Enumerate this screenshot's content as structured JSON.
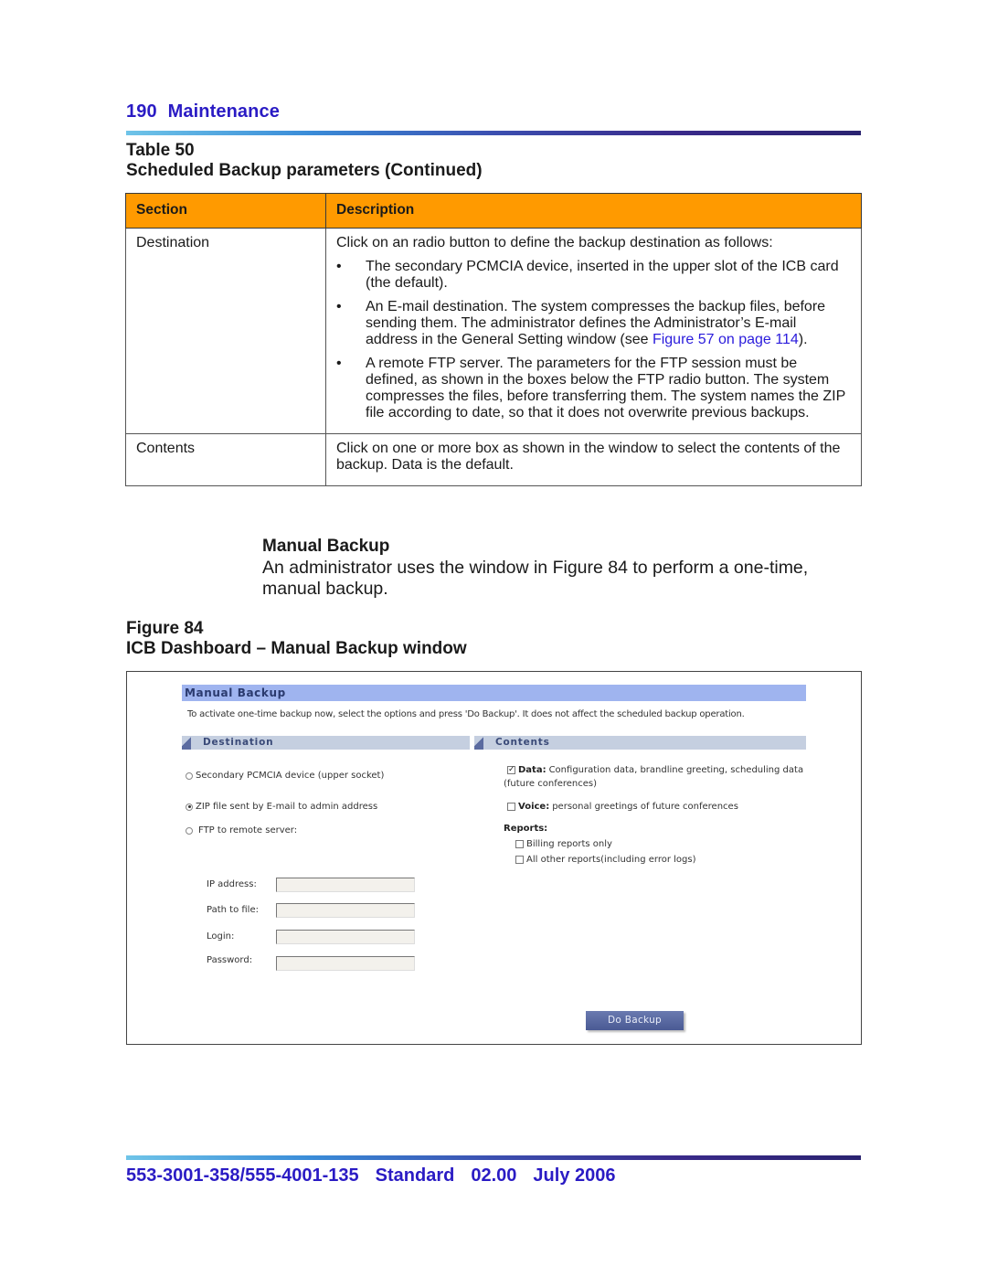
{
  "header": {
    "page_number": "190",
    "chapter": "Maintenance"
  },
  "table": {
    "label": "Table 50",
    "title": "Scheduled Backup parameters (Continued)",
    "columns": [
      "Section",
      "Description"
    ],
    "rows": [
      {
        "section": "Destination",
        "intro": "Click on an radio button to define the backup destination as follows:",
        "bullets": [
          {
            "text": "The secondary PCMCIA device, inserted in the upper slot of the ICB card (the default)."
          },
          {
            "text": "An E-mail destination. The system compresses the backup files, before sending them. The administrator defines the Administrator’s E-mail address in the General Setting window (see ",
            "link": "Figure 57 on page 114",
            "after": ")."
          },
          {
            "text": "A remote FTP server. The parameters for the FTP session must be defined, as shown in the boxes below the FTP radio button. The system compresses the files, before transferring them. The system names the ZIP file according to date, so that it does not overwrite previous backups."
          }
        ]
      },
      {
        "section": "Contents",
        "intro": "Click on one or more box as shown in the window to select the contents of the backup. Data is the default."
      }
    ]
  },
  "manual_backup": {
    "heading": "Manual Backup",
    "body": "An administrator uses the window in Figure 84 to perform a one-time, manual backup."
  },
  "figure": {
    "label": "Figure 84",
    "title": "ICB Dashboard – Manual Backup window"
  },
  "window": {
    "title": "Manual Backup",
    "description": "To activate one-time backup now, select the options and press 'Do Backup'. It does not affect the scheduled backup operation.",
    "destination": {
      "heading": "Destination",
      "options": [
        {
          "label": "Secondary PCMCIA device (upper socket)",
          "selected": false
        },
        {
          "label": "ZIP file sent by E-mail to admin address",
          "selected": true
        },
        {
          "label": "FTP to remote server:",
          "selected": false
        }
      ],
      "ftp_fields": [
        {
          "label": "IP address:",
          "value": ""
        },
        {
          "label": "Path to file:",
          "value": ""
        },
        {
          "label": "Login:",
          "value": ""
        },
        {
          "label": "Password:",
          "value": ""
        }
      ]
    },
    "contents": {
      "heading": "Contents",
      "data": {
        "label": "Data:",
        "desc": "Configuration data, brandline greeting, scheduling data",
        "desc2": "(future conferences)",
        "checked": true
      },
      "voice": {
        "label": "Voice:",
        "desc": "personal greetings of future conferences",
        "checked": false
      },
      "reports_label": "Reports:",
      "reports": [
        {
          "label": "Billing reports only",
          "checked": false
        },
        {
          "label": "All other reports(including error logs)",
          "checked": false
        }
      ]
    },
    "do_backup_label": "Do Backup"
  },
  "footer": {
    "doc_number": "553-3001-358/555-4001-135",
    "status": "Standard",
    "version": "02.00",
    "date": "July 2006"
  }
}
